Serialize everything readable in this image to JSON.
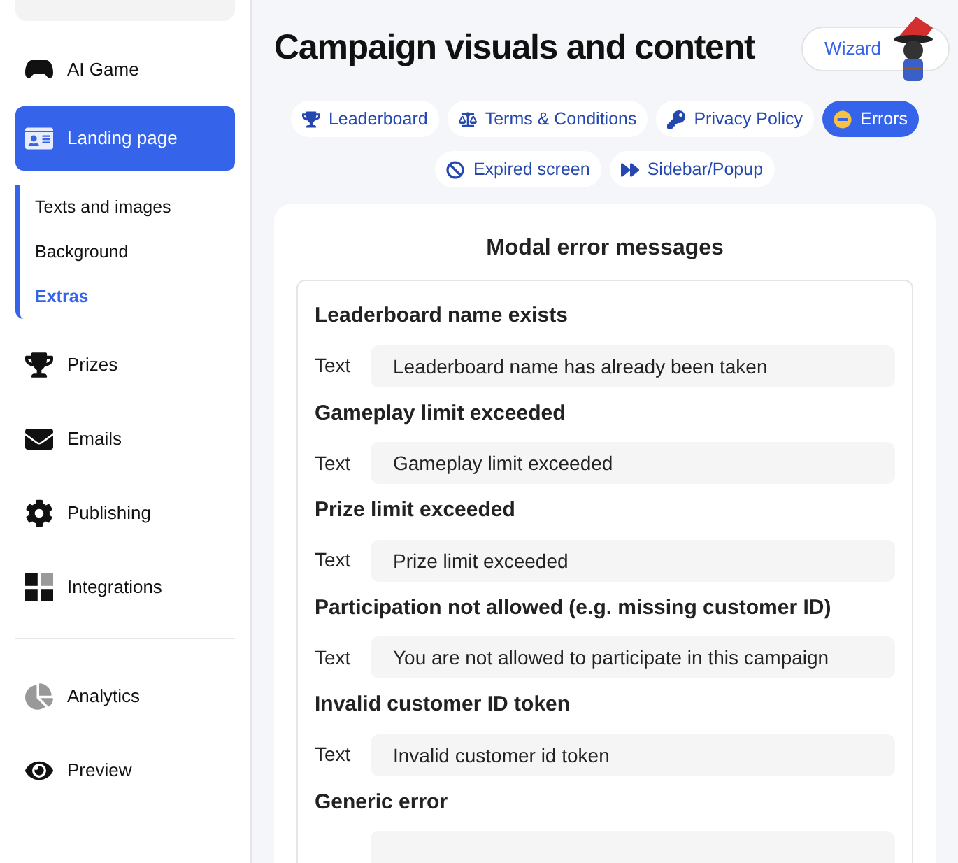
{
  "sidebar": {
    "items": [
      {
        "label": "AI Game",
        "selected": false
      },
      {
        "label": "Landing page",
        "selected": true,
        "children": [
          {
            "label": "Texts and images",
            "selected": false
          },
          {
            "label": "Background",
            "selected": false
          },
          {
            "label": "Extras",
            "selected": true
          }
        ]
      },
      {
        "label": "Prizes",
        "selected": false
      },
      {
        "label": "Emails",
        "selected": false
      },
      {
        "label": "Publishing",
        "selected": false
      },
      {
        "label": "Integrations",
        "selected": false
      }
    ],
    "bottom_items": [
      {
        "label": "Analytics",
        "selected": false
      },
      {
        "label": "Preview",
        "selected": false
      }
    ]
  },
  "header": {
    "title": "Campaign visuals and content",
    "wizard_button": "Wizard"
  },
  "tabs": [
    {
      "label": "Leaderboard",
      "selected": false
    },
    {
      "label": "Terms & Conditions",
      "selected": false
    },
    {
      "label": "Privacy Policy",
      "selected": false
    },
    {
      "label": "Errors",
      "selected": true
    },
    {
      "label": "Expired screen",
      "selected": false
    },
    {
      "label": "Sidebar/Popup",
      "selected": false
    }
  ],
  "panel": {
    "title": "Modal error messages",
    "messages": [
      {
        "heading": "Leaderboard name exists",
        "label": "Text",
        "value": "Leaderboard name has already been taken"
      },
      {
        "heading": "Gameplay limit exceeded",
        "label": "Text",
        "value": "Gameplay limit exceeded"
      },
      {
        "heading": "Prize limit exceeded",
        "label": "Text",
        "value": "Prize limit exceeded"
      },
      {
        "heading": "Participation not allowed (e.g. missing customer ID)",
        "label": "Text",
        "value": "You are not allowed to participate in this campaign"
      },
      {
        "heading": "Invalid customer ID token",
        "label": "Text",
        "value": "Invalid customer id token"
      },
      {
        "heading": "Generic error"
      }
    ]
  }
}
